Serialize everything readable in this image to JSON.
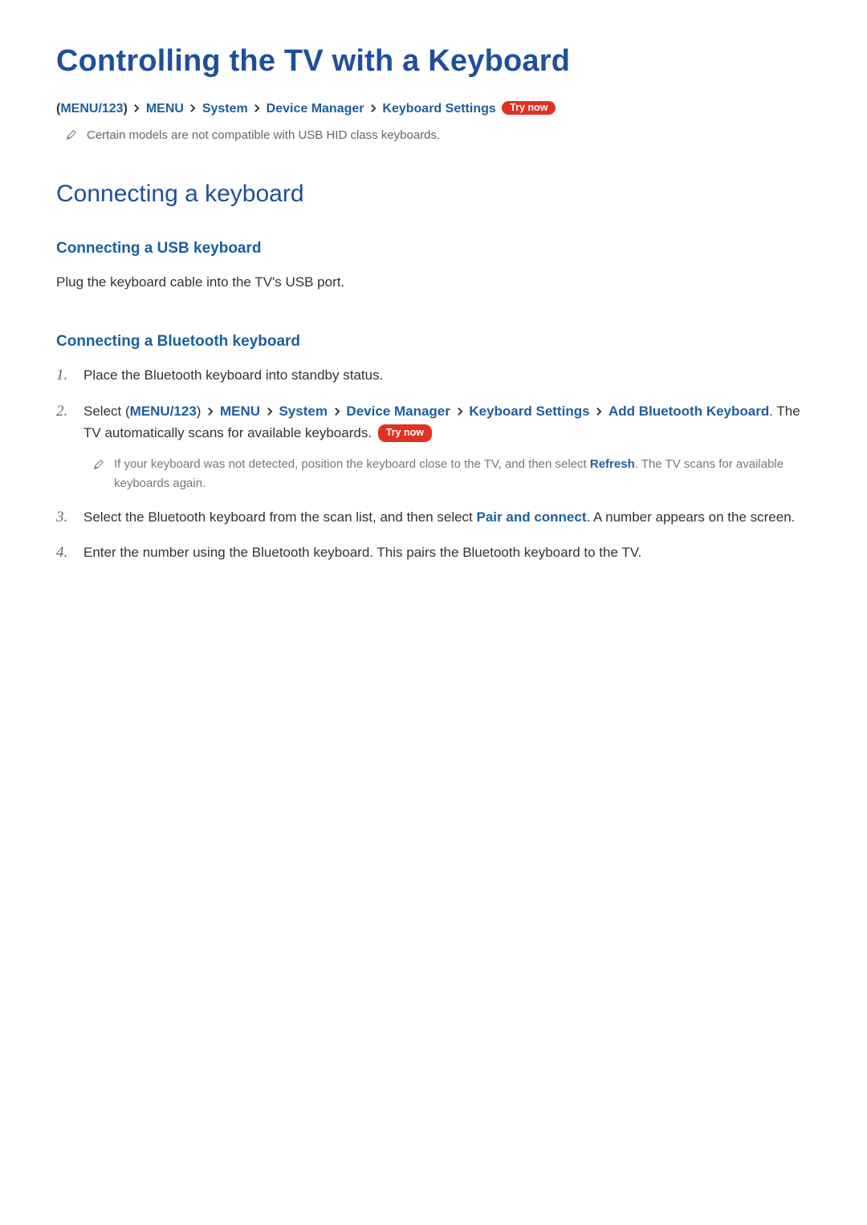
{
  "title": "Controlling the TV with a Keyboard",
  "breadcrumb": {
    "paren_open": "(",
    "paren_close": ")",
    "item0": "MENU/123",
    "item1": "MENU",
    "item2": "System",
    "item3": "Device Manager",
    "item4": "Keyboard Settings"
  },
  "try_now_label": "Try now",
  "note1": "Certain models are not compatible with USB HID class keyboards.",
  "section1": {
    "heading": "Connecting a keyboard",
    "sub1": {
      "heading": "Connecting a USB keyboard",
      "body": "Plug the keyboard cable into the TV's USB port."
    },
    "sub2": {
      "heading": "Connecting a Bluetooth keyboard",
      "steps": {
        "s1": "Place the Bluetooth keyboard into standby status.",
        "s2_pre": "Select ",
        "s2_bc_item0": "MENU/123",
        "s2_bc_item1": "MENU",
        "s2_bc_item2": "System",
        "s2_bc_item3": "Device Manager",
        "s2_bc_item4": "Keyboard Settings",
        "s2_bc_item5": "Add Bluetooth Keyboard",
        "s2_post": ". The TV automatically scans for available keyboards. ",
        "s2_note_pre": "If your keyboard was not detected, position the keyboard close to the TV, and then select ",
        "s2_note_strong": "Refresh",
        "s2_note_post": ". The TV scans for available keyboards again.",
        "s3_pre": "Select the Bluetooth keyboard from the scan list, and then select ",
        "s3_strong": "Pair and connect",
        "s3_post": ". A number appears on the screen.",
        "s4": "Enter the number using the Bluetooth keyboard. This pairs the Bluetooth keyboard to the TV."
      }
    }
  }
}
